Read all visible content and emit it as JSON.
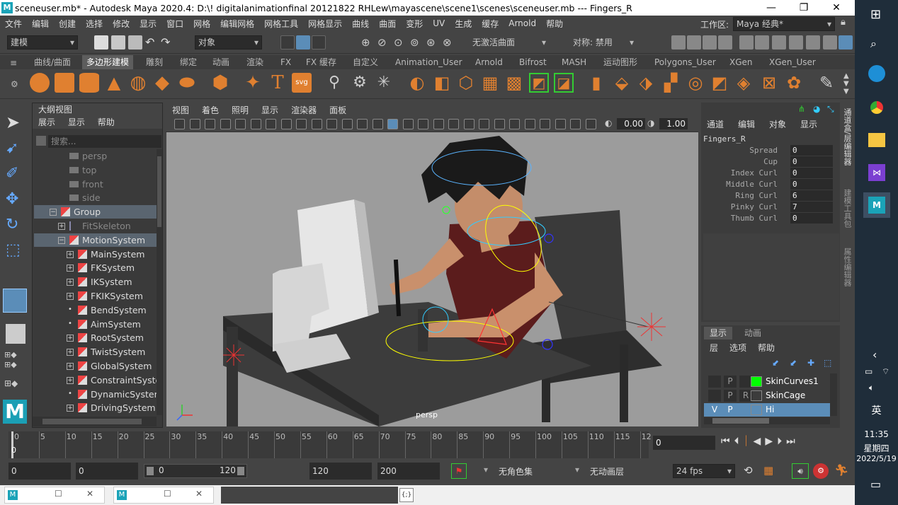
{
  "window": {
    "title": "sceneuser.mb* - Autodesk Maya 2020.4: D:\\!  digitalanimationfinal 20121822 RHLew\\mayascene\\scene1\\scenes\\sceneuser.mb   ---   Fingers_R",
    "logo_letter": "M",
    "minimize": "—",
    "maximize": "❐",
    "close": "✕"
  },
  "menubar": {
    "items": [
      "文件",
      "编辑",
      "创建",
      "选择",
      "修改",
      "显示",
      "窗口",
      "网格",
      "编辑网格",
      "网格工具",
      "网格显示",
      "曲线",
      "曲面",
      "变形",
      "UV",
      "生成",
      "缓存",
      "Arnold",
      "帮助"
    ],
    "workspace_label": "工作区:",
    "workspace_value": "Maya 经典*"
  },
  "statusline": {
    "mode": "建模",
    "object_field": "对象",
    "live_surface": "无激活曲面",
    "symmetry": "对称: 禁用"
  },
  "shelf": {
    "tabs": [
      "曲线/曲面",
      "多边形建模",
      "雕刻",
      "绑定",
      "动画",
      "渲染",
      "FX",
      "FX 缓存",
      "自定义",
      "Animation_User",
      "Arnold",
      "Bifrost",
      "MASH",
      "运动图形",
      "Polygons_User",
      "XGen",
      "XGen_User"
    ],
    "active_tab": "多边形建模",
    "text_icon": "T",
    "svg_icon": "svg"
  },
  "outliner": {
    "title": "大纲视图",
    "menus": [
      "展示",
      "显示",
      "帮助"
    ],
    "search_placeholder": "搜索...",
    "rows": [
      {
        "label": "persp",
        "indent": 1,
        "type": "camera",
        "dim": true
      },
      {
        "label": "top",
        "indent": 1,
        "type": "camera",
        "dim": true
      },
      {
        "label": "front",
        "indent": 1,
        "type": "camera",
        "dim": true
      },
      {
        "label": "side",
        "indent": 1,
        "type": "camera",
        "dim": true
      },
      {
        "label": "Group",
        "indent": 0,
        "type": "group",
        "expand": "−",
        "sel": true
      },
      {
        "label": "FitSkeleton",
        "indent": 1,
        "type": "skeleton",
        "expand": "+",
        "dim": true
      },
      {
        "label": "MotionSystem",
        "indent": 1,
        "type": "group",
        "expand": "−",
        "sel": true
      },
      {
        "label": "MainSystem",
        "indent": 2,
        "type": "group",
        "expand": "+"
      },
      {
        "label": "FKSystem",
        "indent": 2,
        "type": "group",
        "expand": "+"
      },
      {
        "label": "IKSystem",
        "indent": 2,
        "type": "group",
        "expand": "+"
      },
      {
        "label": "FKIKSystem",
        "indent": 2,
        "type": "group",
        "expand": "+"
      },
      {
        "label": "BendSystem",
        "indent": 2,
        "type": "group",
        "expand": "•"
      },
      {
        "label": "AimSystem",
        "indent": 2,
        "type": "group",
        "expand": "•"
      },
      {
        "label": "RootSystem",
        "indent": 2,
        "type": "group",
        "expand": "+"
      },
      {
        "label": "TwistSystem",
        "indent": 2,
        "type": "group",
        "expand": "+"
      },
      {
        "label": "GlobalSystem",
        "indent": 2,
        "type": "group",
        "expand": "+"
      },
      {
        "label": "ConstraintSyster",
        "indent": 2,
        "type": "group",
        "expand": "+"
      },
      {
        "label": "DynamicSystem",
        "indent": 2,
        "type": "group",
        "expand": "•"
      },
      {
        "label": "DrivingSystem",
        "indent": 2,
        "type": "group",
        "expand": "+"
      }
    ]
  },
  "viewport": {
    "menus": [
      "视图",
      "着色",
      "照明",
      "显示",
      "渲染器",
      "面板"
    ],
    "value_a": "0.00",
    "value_b": "1.00",
    "camera_label": "persp"
  },
  "channelbox": {
    "menus": [
      "通道",
      "编辑",
      "对象",
      "显示"
    ],
    "node": "Fingers_R",
    "attrs": [
      {
        "name": "Spread",
        "value": "0"
      },
      {
        "name": "Cup",
        "value": "0"
      },
      {
        "name": "Index Curl",
        "value": "0"
      },
      {
        "name": "Middle Curl",
        "value": "0"
      },
      {
        "name": "Ring Curl",
        "value": "6"
      },
      {
        "name": "Pinky Curl",
        "value": "7"
      },
      {
        "name": "Thumb Curl",
        "value": "0"
      }
    ],
    "side_tabs": [
      "通道盒/层编辑器",
      "建模工具包",
      "属性编辑器"
    ]
  },
  "layers": {
    "tabs": [
      "显示",
      "动画"
    ],
    "menus": [
      "层",
      "选项",
      "帮助"
    ],
    "rows": [
      {
        "v": "",
        "p": "P",
        "r": "",
        "name": "SkinCurves1",
        "color": "#00ff00"
      },
      {
        "v": "",
        "p": "P",
        "r": "R",
        "name": "SkinCage",
        "color": ""
      },
      {
        "v": "V",
        "p": "P",
        "r": "",
        "name": "Hi",
        "color": "",
        "sel": true
      }
    ]
  },
  "timeline": {
    "ticks": [
      "0",
      "5",
      "10",
      "15",
      "20",
      "25",
      "30",
      "35",
      "40",
      "45",
      "50",
      "55",
      "60",
      "65",
      "70",
      "75",
      "80",
      "85",
      "90",
      "95",
      "100",
      "105",
      "110",
      "115",
      "12"
    ],
    "current_frame": "0",
    "frame_field": "0"
  },
  "range": {
    "start": "0",
    "start2": "0",
    "slider_start": "0",
    "slider_end": "120",
    "end": "120",
    "end2": "200",
    "charset": "无角色集",
    "animlayer": "无动画层",
    "fps": "24 fps"
  },
  "bottom": {
    "win1_logo": "M",
    "win2_logo": "M",
    "script_icon": "{;}"
  },
  "taskbar": {
    "ime": "英",
    "time": "11:35",
    "weekday": "星期四",
    "date": "2022/5/19"
  }
}
